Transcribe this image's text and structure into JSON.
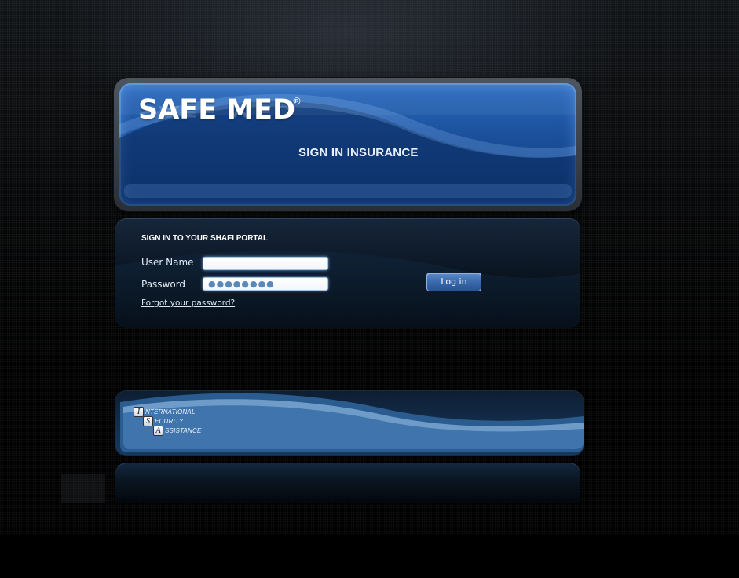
{
  "brand": {
    "name": "SAFE MED",
    "registered_mark": "®",
    "subtitle": "SIGN IN INSURANCE"
  },
  "login": {
    "heading": "SIGN IN TO YOUR SHAFI PORTAL",
    "username_label": "User Name",
    "username_value": "",
    "password_label": "Password",
    "password_value": "●●●●●●●●",
    "forgot_link": "Forgot your password?",
    "submit_label": "Log in"
  },
  "footer": {
    "logo_letters": [
      "I",
      "S",
      "A"
    ],
    "logo_words": [
      "NTERNATIONAL",
      "ECURITY",
      "SSISTANCE"
    ]
  },
  "colors": {
    "background": "#000000",
    "header_blue": "#1a4f9a",
    "input_border": "#9fc4e8",
    "button_blue": "#3a69ac"
  }
}
